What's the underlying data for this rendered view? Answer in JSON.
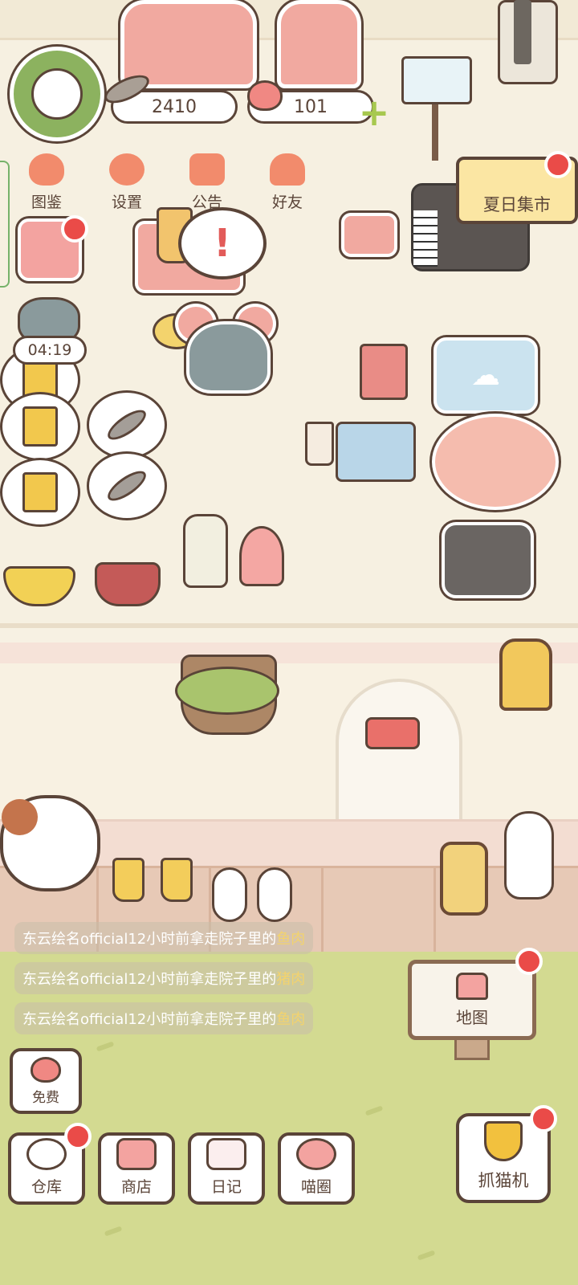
{
  "hud": {
    "fish_coins": "2410",
    "hearts": "101"
  },
  "menu": {
    "items": [
      {
        "label": "图鉴",
        "icon": "cat-face-icon",
        "color": "#f28b6c"
      },
      {
        "label": "设置",
        "icon": "gear-icon",
        "color": "#f28b6c"
      },
      {
        "label": "公告",
        "icon": "gift-icon",
        "color": "#f28b6c"
      },
      {
        "label": "好友",
        "icon": "friends-icon",
        "color": "#f28b6c"
      }
    ]
  },
  "timer": "04:19",
  "alert_mark": "!",
  "market_sign": "夏日集市",
  "feed": [
    {
      "prefix": "东云绘名official12小时前拿走院子里的",
      "item": "鱼肉"
    },
    {
      "prefix": "东云绘名official12小时前拿走院子里的",
      "item": "猪肉"
    },
    {
      "prefix": "东云绘名official12小时前拿走院子里的",
      "item": "鱼肉"
    }
  ],
  "map_label": "地图",
  "free_label": "免费",
  "bottom_nav": [
    {
      "label": "仓库",
      "icon": "storage-icon",
      "badge": true
    },
    {
      "label": "商店",
      "icon": "shop-icon",
      "badge": false
    },
    {
      "label": "日记",
      "icon": "diary-icon",
      "badge": false
    },
    {
      "label": "喵圈",
      "icon": "cat-planet-icon",
      "badge": false
    }
  ],
  "claw_label": "抓猫机",
  "colors": {
    "accent_pink": "#f3a3a0",
    "badge_red": "#ea4b48",
    "outline": "#5a4438",
    "grass": "#d3da91",
    "highlight_text": "#f3d36d"
  }
}
